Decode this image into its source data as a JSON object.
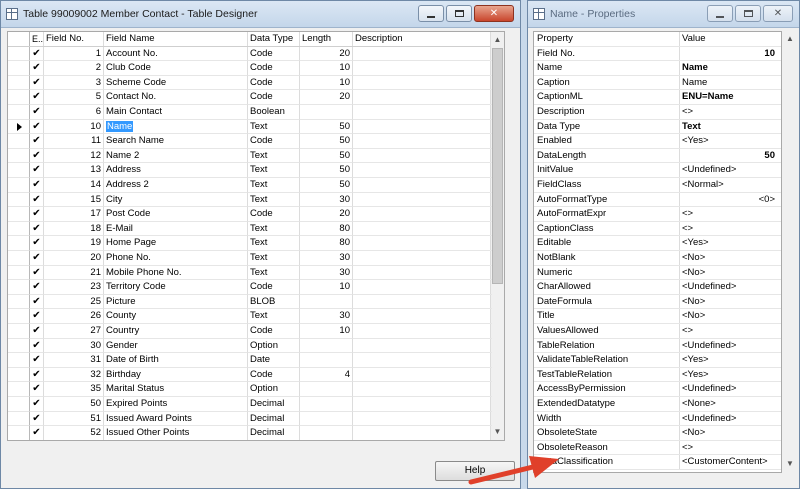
{
  "designer": {
    "title": "Table 99009002 Member Contact - Table Designer",
    "columns": {
      "enabled": "E..",
      "field_no": "Field No.",
      "field_name": "Field Name",
      "data_type": "Data Type",
      "length": "Length",
      "description": "Description"
    },
    "rows": [
      {
        "check": "✔",
        "no": "1",
        "name": "Account No.",
        "type": "Code",
        "length": "20"
      },
      {
        "check": "✔",
        "no": "2",
        "name": "Club Code",
        "type": "Code",
        "length": "10"
      },
      {
        "check": "✔",
        "no": "3",
        "name": "Scheme Code",
        "type": "Code",
        "length": "10"
      },
      {
        "check": "✔",
        "no": "5",
        "name": "Contact No.",
        "type": "Code",
        "length": "20"
      },
      {
        "check": "✔",
        "no": "6",
        "name": "Main Contact",
        "type": "Boolean",
        "length": ""
      },
      {
        "check": "✔",
        "no": "10",
        "name": "Name",
        "type": "Text",
        "length": "50",
        "selected": true
      },
      {
        "check": "✔",
        "no": "11",
        "name": "Search Name",
        "type": "Code",
        "length": "50"
      },
      {
        "check": "✔",
        "no": "12",
        "name": "Name 2",
        "type": "Text",
        "length": "50"
      },
      {
        "check": "✔",
        "no": "13",
        "name": "Address",
        "type": "Text",
        "length": "50"
      },
      {
        "check": "✔",
        "no": "14",
        "name": "Address 2",
        "type": "Text",
        "length": "50"
      },
      {
        "check": "✔",
        "no": "15",
        "name": "City",
        "type": "Text",
        "length": "30"
      },
      {
        "check": "✔",
        "no": "17",
        "name": "Post Code",
        "type": "Code",
        "length": "20"
      },
      {
        "check": "✔",
        "no": "18",
        "name": "E-Mail",
        "type": "Text",
        "length": "80"
      },
      {
        "check": "✔",
        "no": "19",
        "name": "Home Page",
        "type": "Text",
        "length": "80"
      },
      {
        "check": "✔",
        "no": "20",
        "name": "Phone No.",
        "type": "Text",
        "length": "30"
      },
      {
        "check": "✔",
        "no": "21",
        "name": "Mobile Phone No.",
        "type": "Text",
        "length": "30"
      },
      {
        "check": "✔",
        "no": "23",
        "name": "Territory Code",
        "type": "Code",
        "length": "10"
      },
      {
        "check": "✔",
        "no": "25",
        "name": "Picture",
        "type": "BLOB",
        "length": ""
      },
      {
        "check": "✔",
        "no": "26",
        "name": "County",
        "type": "Text",
        "length": "30"
      },
      {
        "check": "✔",
        "no": "27",
        "name": "Country",
        "type": "Code",
        "length": "10"
      },
      {
        "check": "✔",
        "no": "30",
        "name": "Gender",
        "type": "Option",
        "length": ""
      },
      {
        "check": "✔",
        "no": "31",
        "name": "Date of Birth",
        "type": "Date",
        "length": ""
      },
      {
        "check": "✔",
        "no": "32",
        "name": "Birthday",
        "type": "Code",
        "length": "4"
      },
      {
        "check": "✔",
        "no": "35",
        "name": "Marital Status",
        "type": "Option",
        "length": ""
      },
      {
        "check": "✔",
        "no": "50",
        "name": "Expired Points",
        "type": "Decimal",
        "length": ""
      },
      {
        "check": "✔",
        "no": "51",
        "name": "Issued Award Points",
        "type": "Decimal",
        "length": ""
      },
      {
        "check": "✔",
        "no": "52",
        "name": "Issued Other Points",
        "type": "Decimal",
        "length": ""
      }
    ],
    "help_label": "Help"
  },
  "properties": {
    "title": "Name - Properties",
    "columns": {
      "property": "Property",
      "value": "Value"
    },
    "rows": [
      {
        "prop": "Field No.",
        "val": "10",
        "style": "bold right"
      },
      {
        "prop": "Name",
        "val": "Name",
        "style": "bold"
      },
      {
        "prop": "Caption",
        "val": "Name",
        "style": ""
      },
      {
        "prop": "CaptionML",
        "val": "ENU=Name",
        "style": "bold"
      },
      {
        "prop": "Description",
        "val": "<>",
        "style": ""
      },
      {
        "prop": "Data Type",
        "val": "Text",
        "style": "bold"
      },
      {
        "prop": "Enabled",
        "val": "<Yes>",
        "style": ""
      },
      {
        "prop": "DataLength",
        "val": "50",
        "style": "bold right"
      },
      {
        "prop": "InitValue",
        "val": "<Undefined>",
        "style": ""
      },
      {
        "prop": "FieldClass",
        "val": "<Normal>",
        "style": ""
      },
      {
        "prop": "AutoFormatType",
        "val": "<0>",
        "style": "right"
      },
      {
        "prop": "AutoFormatExpr",
        "val": "<>",
        "style": ""
      },
      {
        "prop": "CaptionClass",
        "val": "<>",
        "style": ""
      },
      {
        "prop": "Editable",
        "val": "<Yes>",
        "style": ""
      },
      {
        "prop": "NotBlank",
        "val": "<No>",
        "style": ""
      },
      {
        "prop": "Numeric",
        "val": "<No>",
        "style": ""
      },
      {
        "prop": "CharAllowed",
        "val": "<Undefined>",
        "style": ""
      },
      {
        "prop": "DateFormula",
        "val": "<No>",
        "style": ""
      },
      {
        "prop": "Title",
        "val": "<No>",
        "style": ""
      },
      {
        "prop": "ValuesAllowed",
        "val": "<>",
        "style": ""
      },
      {
        "prop": "TableRelation",
        "val": "<Undefined>",
        "style": ""
      },
      {
        "prop": "ValidateTableRelation",
        "val": "<Yes>",
        "style": ""
      },
      {
        "prop": "TestTableRelation",
        "val": "<Yes>",
        "style": ""
      },
      {
        "prop": "AccessByPermission",
        "val": "<Undefined>",
        "style": ""
      },
      {
        "prop": "ExtendedDatatype",
        "val": "<None>",
        "style": ""
      },
      {
        "prop": "Width",
        "val": "<Undefined>",
        "style": ""
      },
      {
        "prop": "ObsoleteState",
        "val": "<No>",
        "style": ""
      },
      {
        "prop": "ObsoleteReason",
        "val": "<>",
        "style": ""
      },
      {
        "prop": "DataClassification",
        "val": "<CustomerContent>",
        "style": ""
      }
    ]
  },
  "colors": {
    "selection": "#3399ff",
    "arrow": "#e0402a",
    "desktop": "#c9d9ea"
  }
}
